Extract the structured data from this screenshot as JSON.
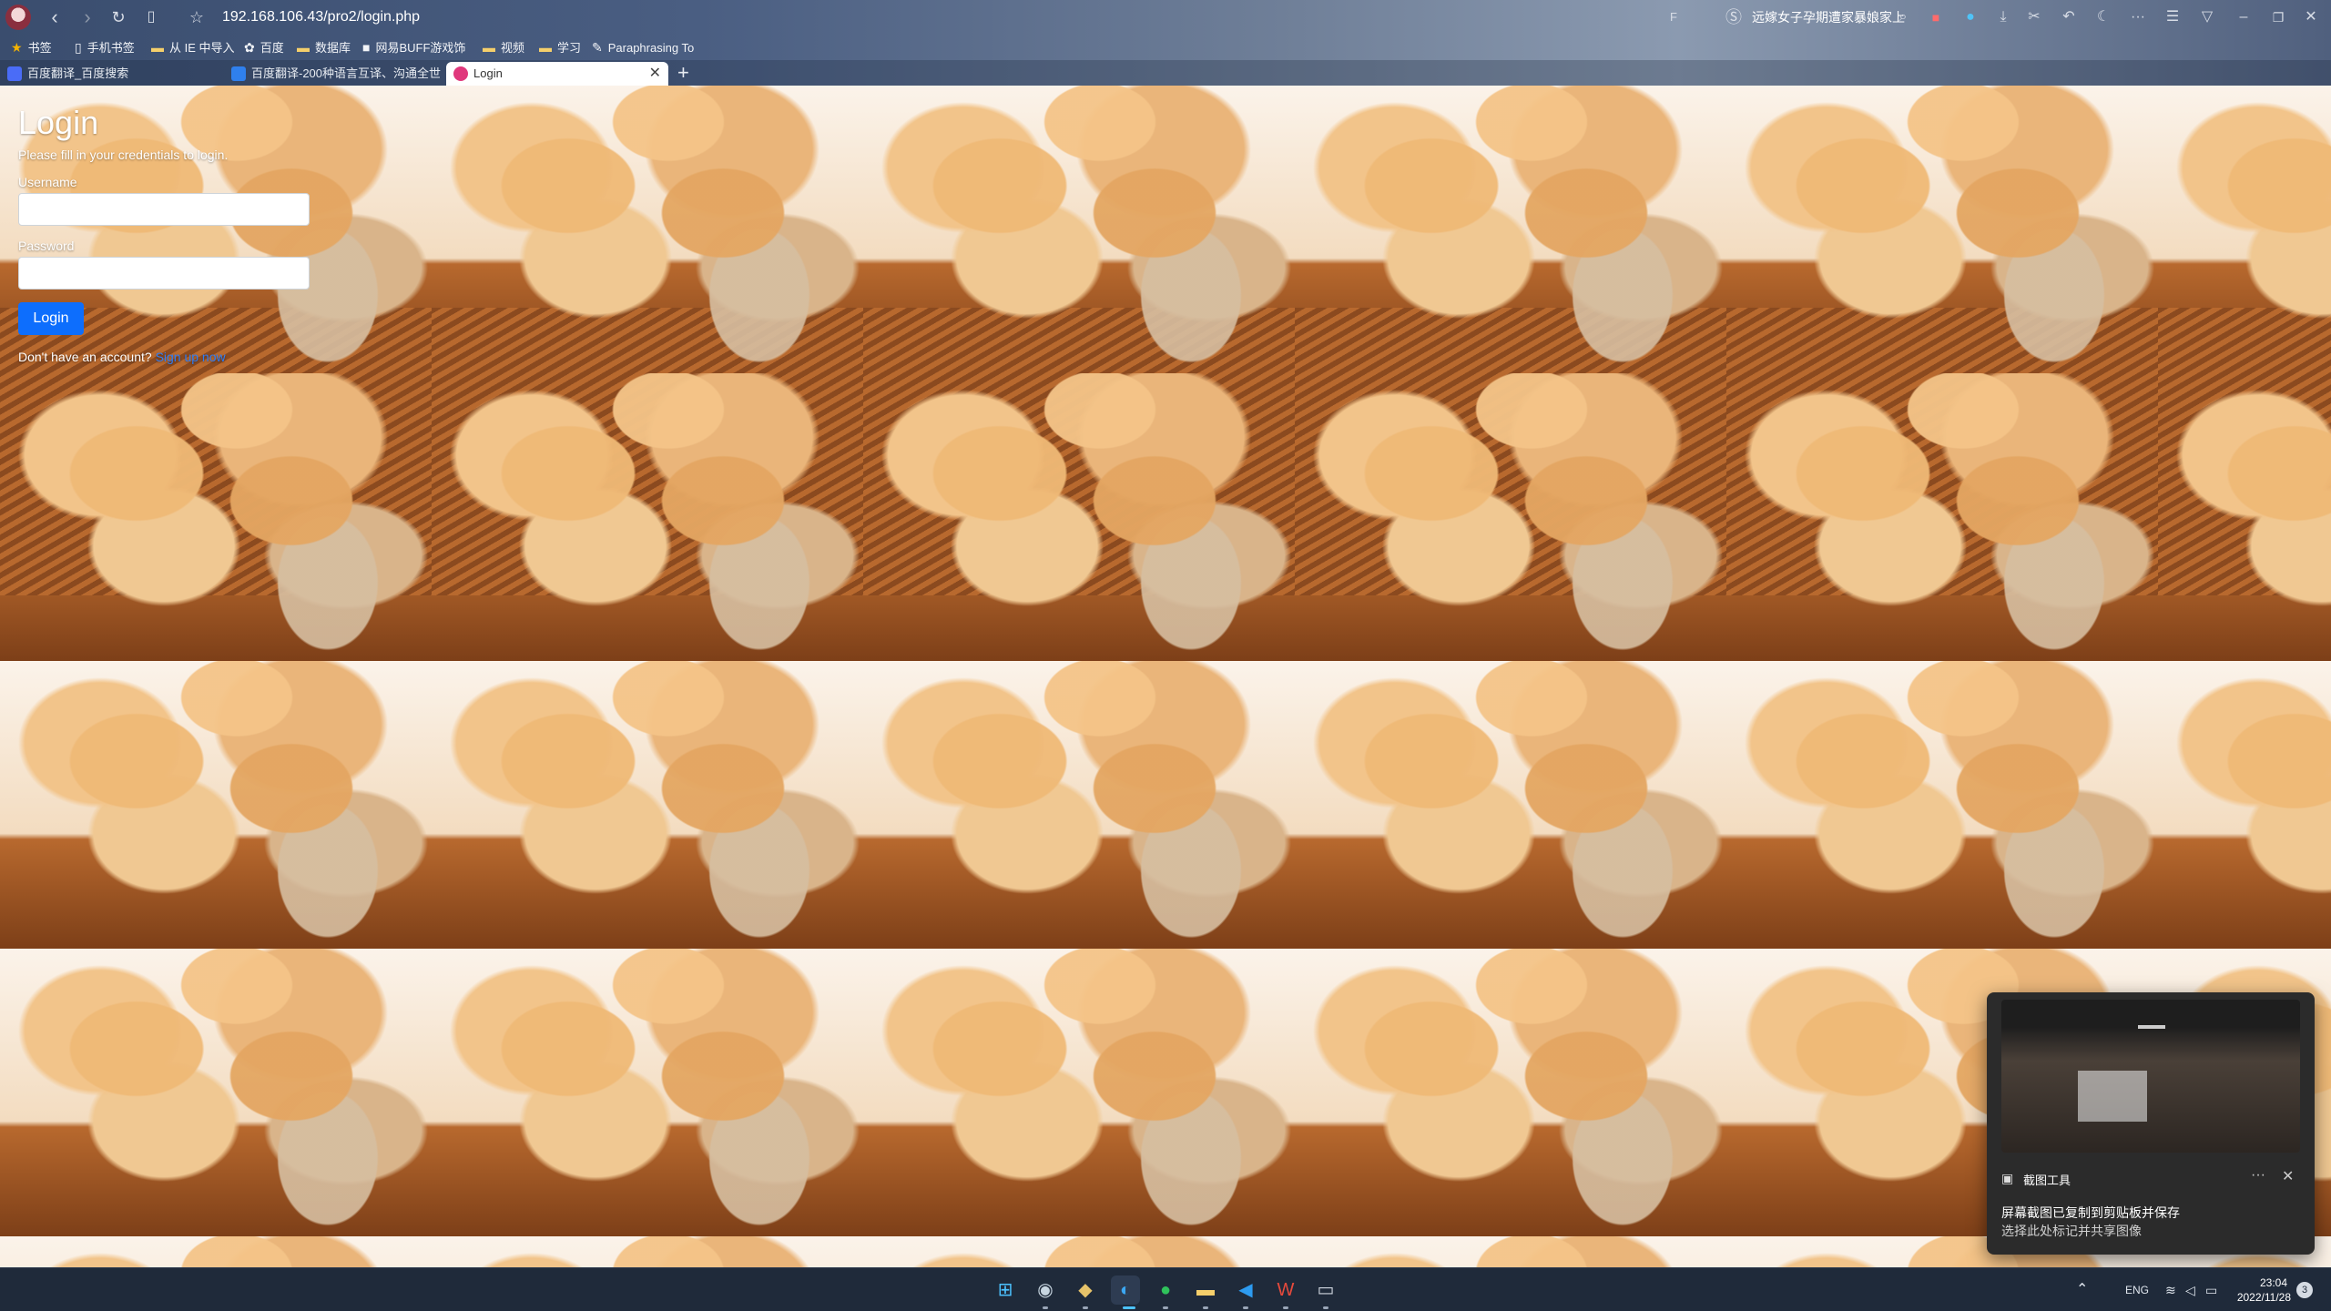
{
  "browser": {
    "url": "192.168.106.43/pro2/login.php",
    "top_right_text": "远嫁女子孕期遭家暴娘家上",
    "bookmarks": [
      {
        "label": "书签",
        "icon": "star-icon"
      },
      {
        "label": "手机书签",
        "icon": "phone-icon"
      },
      {
        "label": "从 IE 中导入",
        "icon": "folder-icon"
      },
      {
        "label": "百度",
        "icon": "baidu-icon"
      },
      {
        "label": "数据库",
        "icon": "folder-icon"
      },
      {
        "label": "网易BUFF游戏饰",
        "icon": "buff-icon"
      },
      {
        "label": "视频",
        "icon": "folder-icon"
      },
      {
        "label": "学习",
        "icon": "folder-icon"
      },
      {
        "label": "Paraphrasing To",
        "icon": "pen-icon"
      }
    ],
    "tabs": [
      {
        "label": "百度翻译_百度搜索"
      },
      {
        "label": "百度翻译-200种语言互译、沟通全世"
      },
      {
        "label": "Login"
      }
    ],
    "active_tab": 2
  },
  "login": {
    "title": "Login",
    "description": "Please fill in your credentials to login.",
    "username_label": "Username",
    "username_value": "",
    "password_label": "Password",
    "password_value": "",
    "button_label": "Login",
    "signup_prompt": "Don't have an account?",
    "signup_link": "Sign up now"
  },
  "notification": {
    "app_name": "截图工具",
    "line1": "屏幕截图已复制到剪贴板并保存",
    "line2": "选择此处标记并共享图像",
    "more_glyph": "···",
    "close_glyph": "✕"
  },
  "taskbar": {
    "apps": [
      "windows-start",
      "steam",
      "terminal-app",
      "edge",
      "wechat",
      "file-explorer",
      "vscode",
      "wps",
      "cmd"
    ],
    "language": "ENG",
    "time": "23:04",
    "date": "2022/11/28",
    "notification_count": "3"
  },
  "colors": {
    "accent_button": "#0d6efd",
    "link": "#2f7df6"
  }
}
